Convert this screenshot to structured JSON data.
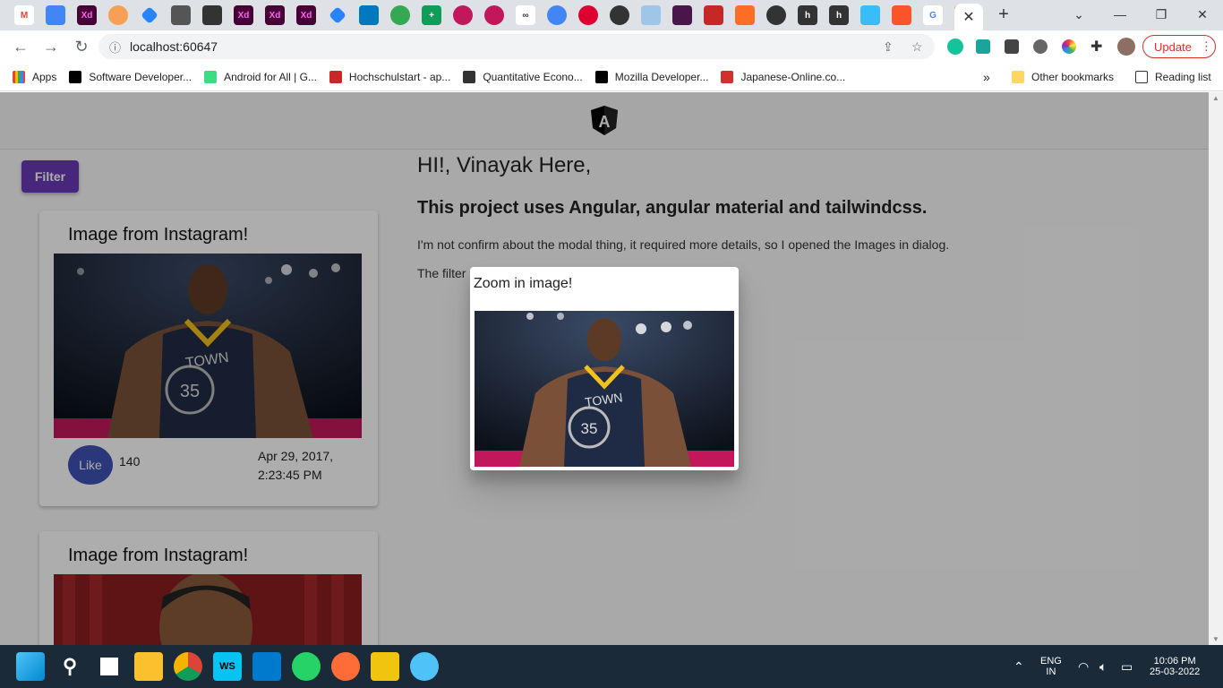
{
  "browser": {
    "close_tab_glyph": "✕",
    "new_tab_glyph": "+",
    "url": "localhost:60647",
    "update_label": "Update",
    "bookmarks": [
      {
        "label": "Apps",
        "color": "#ea4335"
      },
      {
        "label": "Software Developer...",
        "color": "#000000"
      },
      {
        "label": "Android for All  |  G...",
        "color": "#3ddc84"
      },
      {
        "label": "Hochschulstart - ap...",
        "color": "#c62828"
      },
      {
        "label": "Quantitative Econo...",
        "color": "#333333"
      },
      {
        "label": "Mozilla Developer...",
        "color": "#000000"
      },
      {
        "label": "Japanese-Online.co...",
        "color": "#d32f2f"
      }
    ],
    "other_bookmarks": "Other bookmarks",
    "reading_list": "Reading list",
    "more_glyph": "»"
  },
  "sidebar": {
    "filter_label": "Filter",
    "cards": [
      {
        "title": "Image from Instagram!",
        "like_label": "Like",
        "likes": "140",
        "date_line1": "Apr 29, 2017,",
        "date_line2": "2:23:45 PM"
      },
      {
        "title": "Image from Instagram!"
      }
    ]
  },
  "main": {
    "greeting": "HI!, Vinayak Here,",
    "subheading": "This project uses Angular, angular material and tailwindcss.",
    "note": "I'm not confirm about the modal thing, it required more details, so I opened the Images in dialog.",
    "note2": "The filter"
  },
  "dialog": {
    "title": "Zoom in image!"
  },
  "taskbar": {
    "lang_line1": "ENG",
    "lang_line2": "IN",
    "time": "10:06 PM",
    "date": "25-03-2022"
  }
}
